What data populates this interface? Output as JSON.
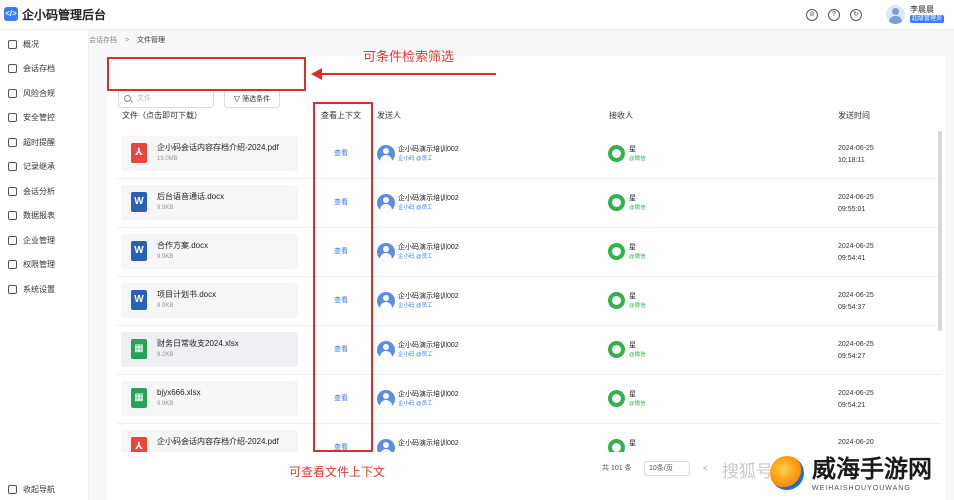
{
  "app": {
    "title": "企小码管理后台",
    "logo_text": "</>"
  },
  "header": {
    "user_name": "李晨晨",
    "user_role": "超级管理员"
  },
  "sidebar": {
    "items": [
      {
        "label": "概况"
      },
      {
        "label": "会话存档"
      },
      {
        "label": "风险合规"
      },
      {
        "label": "安全管控"
      },
      {
        "label": "超时提醒"
      },
      {
        "label": "记录继承"
      },
      {
        "label": "会话分析"
      },
      {
        "label": "数据报表"
      },
      {
        "label": "企业管理"
      },
      {
        "label": "权限管理"
      },
      {
        "label": "系统设置"
      }
    ],
    "collapse_label": "收起导航"
  },
  "breadcrumb": {
    "parent": "会话存档",
    "separator": ">",
    "current": "文件管理"
  },
  "filters": {
    "search_placeholder": "文件",
    "filter_button": "筛选条件",
    "filter_icon": "funnel-icon"
  },
  "annotations": {
    "top": "可条件检索筛选",
    "bottom": "可查看文件上下文"
  },
  "table": {
    "columns": [
      "文件（点击即可下载）",
      "查看上下文",
      "发送人",
      "接收人",
      "发送时间"
    ],
    "rows": [
      {
        "file": "企小码会话内容存档介绍-2024.pdf",
        "size": "19.0MB",
        "type": "pdf",
        "action": "查看",
        "sender": "企小码演示培训002",
        "sender_sub": "企小码 @员工",
        "receiver": "星",
        "receiver_sub": "@微信",
        "date": "2024-06-25",
        "time": "10:18:11"
      },
      {
        "file": "后台语音通话.docx",
        "size": "9.9KB",
        "type": "word",
        "action": "查看",
        "sender": "企小码演示培训002",
        "sender_sub": "企小码 @员工",
        "receiver": "星",
        "receiver_sub": "@微信",
        "date": "2024-06-25",
        "time": "09:55:01"
      },
      {
        "file": "合作方案.docx",
        "size": "9.9KB",
        "type": "word",
        "action": "查看",
        "sender": "企小码演示培训002",
        "sender_sub": "企小码 @员工",
        "receiver": "星",
        "receiver_sub": "@微信",
        "date": "2024-06-25",
        "time": "09:54:41"
      },
      {
        "file": "项目计划书.docx",
        "size": "9.9KB",
        "type": "word",
        "action": "查看",
        "sender": "企小码演示培训002",
        "sender_sub": "企小码 @员工",
        "receiver": "星",
        "receiver_sub": "@微信",
        "date": "2024-06-25",
        "time": "09:54:37"
      },
      {
        "file": "财务日常收支2024.xlsx",
        "size": "9.2KB",
        "type": "excel",
        "action": "查看",
        "sender": "企小码演示培训002",
        "sender_sub": "企小码 @员工",
        "receiver": "星",
        "receiver_sub": "@微信",
        "date": "2024-06-25",
        "time": "09:54:27"
      },
      {
        "file": "bjyx666.xlsx",
        "size": "9.9KB",
        "type": "excel",
        "action": "查看",
        "sender": "企小码演示培训002",
        "sender_sub": "企小码 @员工",
        "receiver": "星",
        "receiver_sub": "@微信",
        "date": "2024-06-25",
        "time": "09:54:21"
      },
      {
        "file": "企小码会话内容存档介绍-2024.pdf",
        "size": "",
        "type": "pdf",
        "action": "查看",
        "sender": "企小码演示培训002",
        "sender_sub": "",
        "receiver": "星",
        "receiver_sub": "",
        "date": "2024-06-20",
        "time": ""
      }
    ]
  },
  "pagination": {
    "total": "共 101 条",
    "page_size": "10条/页",
    "prev": "<"
  },
  "watermark": {
    "left": "搜狐号",
    "brand": "威海手游网",
    "domain": "WEIHAISHOUYOUWANG"
  },
  "colors": {
    "accent": "#3a7bf7",
    "annotation": "#d8312b",
    "wechat": "#2fb34b"
  }
}
